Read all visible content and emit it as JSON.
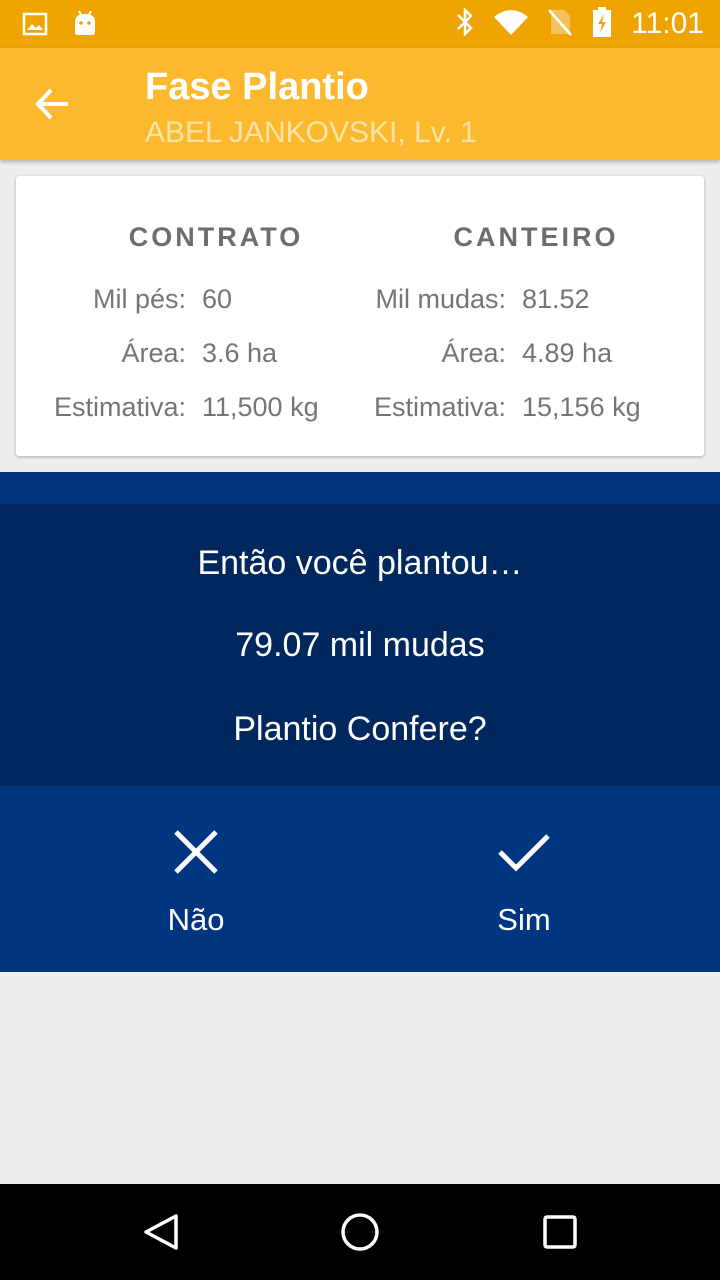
{
  "status_bar": {
    "time": "11:01",
    "left_icons": [
      "image-icon",
      "android-icon"
    ],
    "right_icons": [
      "bluetooth-icon",
      "wifi-icon",
      "no-sim-icon",
      "battery-charging-icon"
    ]
  },
  "app_bar": {
    "title": "Fase Plantio",
    "subtitle": "ABEL JANKOVSKI, Lv. 1",
    "back_icon": "arrow-back-icon"
  },
  "summary": {
    "contrato": {
      "heading": "CONTRATO",
      "rows": [
        {
          "label": "Mil pés:",
          "value": "60"
        },
        {
          "label": "Área:",
          "value": "3.6 ha"
        },
        {
          "label": "Estimativa:",
          "value": "11,500 kg"
        }
      ]
    },
    "canteiro": {
      "heading": "CANTEIRO",
      "rows": [
        {
          "label": "Mil mudas:",
          "value": "81.52"
        },
        {
          "label": "Área:",
          "value": "4.89 ha"
        },
        {
          "label": "Estimativa:",
          "value": "15,156 kg"
        }
      ]
    }
  },
  "dialog": {
    "line1": "Então você plantou…",
    "line2": "79.07 mil mudas",
    "line3": "Plantio Confere?"
  },
  "actions": {
    "no_label": "Não",
    "yes_label": "Sim"
  },
  "colors": {
    "status_bar": "#f0a402",
    "app_bar": "#fdb92d",
    "dialog_bg": "#00285e",
    "actions_bg": "#00357f"
  }
}
